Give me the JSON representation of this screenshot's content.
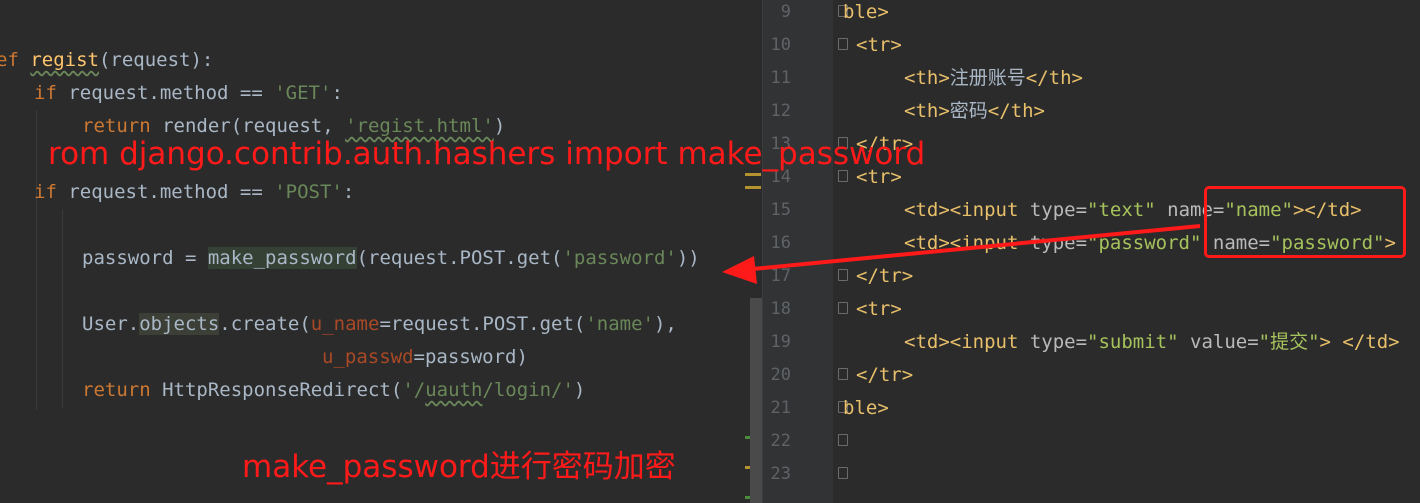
{
  "left_code": {
    "def_kw": "ef",
    "func_name": "regist",
    "func_sig": "(request):",
    "if1_kw": "if",
    "if1_rest": " request.method == ",
    "get_str": "'GET'",
    "colon": ":",
    "return_kw": "return",
    "render_call": " render(request, ",
    "regist_html": "'regist.html'",
    "close_paren": ")",
    "if2_kw": "if",
    "if2_rest": " request.method == ",
    "post_str": "'POST'",
    "pw_assign": "password = ",
    "make_pw": "make_password",
    "pw_call_rest": "(request.POST.get(",
    "pw_key": "'password'",
    "pw_close": "))",
    "user_prefix": "User.",
    "objects": "objects",
    "create_call": ".create(",
    "u_name": "u_name",
    "u_name_rest": "=request.POST.get(",
    "name_key": "'name'",
    "u_name_close": "),",
    "u_passwd": "u_passwd",
    "u_passwd_rest": "=password)",
    "return2_kw": "return",
    "redirect_call": " HttpResponseRedirect(",
    "redirect_url_prefix": "'/",
    "redirect_uauth": "uauth",
    "redirect_url_suffix": "/login/'",
    "redirect_close": ")"
  },
  "right_code": {
    "line_numbers": [
      "9",
      "10",
      "11",
      "12",
      "13",
      "14",
      "15",
      "16",
      "17",
      "18",
      "19",
      "20",
      "21",
      "22",
      "23"
    ],
    "l9": "ble>",
    "l10": "<tr>",
    "l11_open": "<th>",
    "l11_text": "注册账号",
    "l11_close": "</th>",
    "l12_open": "<th>",
    "l12_text": "密码",
    "l12_close": "</th>",
    "l13": "</tr>",
    "l14": "<tr>",
    "l15_a": "<td><input ",
    "l15_attr1": "type=",
    "l15_val1": "\"text\"",
    "l15_attr2": " name=",
    "l15_val2": "\"name\"",
    "l15_end": "></td>",
    "l16_a": "<td><input ",
    "l16_attr1": "type=",
    "l16_val1": "\"password\"",
    "l16_attr2": " name=",
    "l16_val2": "\"password\"",
    "l16_end": ">",
    "l17": "</tr>",
    "l18": "<tr>",
    "l19_a": "<td><input ",
    "l19_attr1": "type=",
    "l19_val1": "\"submit\"",
    "l19_attr2": " value=",
    "l19_val2": "\"提交\"",
    "l19_end": "> </td>",
    "l20": "</tr>",
    "l21": "ble>"
  },
  "annotations": {
    "import_note": "rom django.contrib.auth.hashers import make_password",
    "make_password_note": "make_password进行密码加密"
  },
  "colors": {
    "background": "#2b2b2b",
    "annotation_red": "#ff1a1a",
    "keyword": "#cc7832",
    "string": "#6a8759",
    "function": "#ffc66d",
    "tag": "#e8bf6a"
  }
}
